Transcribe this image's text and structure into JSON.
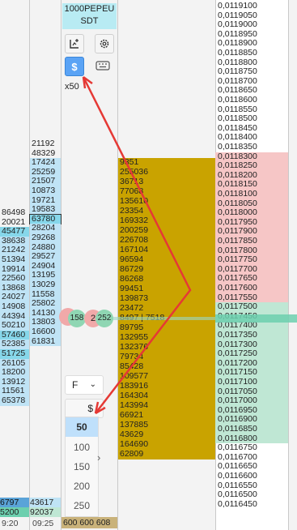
{
  "header": {
    "symbol_line1": "1000PEPEU",
    "symbol_line2": "SDT"
  },
  "toolbar": {
    "leverage": "x50",
    "dollar_icon": "$"
  },
  "order_panel": {
    "select_value": "F",
    "dollar_field": "$",
    "qty_options": [
      "50",
      "100",
      "150",
      "200",
      "250"
    ],
    "selected": "50",
    "chevron": "›"
  },
  "prices": [
    "0,0119100",
    "0,0119050",
    "0,0119000",
    "0,0118950",
    "0,0118900",
    "0,0118850",
    "0,0118800",
    "0,0118750",
    "0,0118700",
    "0,0118650",
    "0,0118600",
    "0,0118550",
    "0,0118500",
    "0,0118450",
    "0,0118400",
    "0,0118350",
    "0,0118300",
    "0,0118250",
    "0,0118200",
    "0,0118150",
    "0,0118100",
    "0,0118050",
    "0,0118000",
    "0,0117950",
    "0,0117900",
    "0,0117850",
    "0,0117800",
    "0,0117750",
    "0,0117700",
    "0,0117650",
    "0,0117600",
    "0,0117550",
    "0,0117500",
    "0,0117450",
    "0,0117400",
    "0,0117350",
    "0,0117300",
    "0,0117250",
    "0,0117200",
    "0,0117150",
    "0,0117100",
    "0,0117050",
    "0,0117000",
    "0,0116950",
    "0,0116900",
    "0,0116850",
    "0,0116800",
    "0,0116750",
    "0,0116700",
    "0,0116650",
    "0,0116600",
    "0,0116550",
    "0,0116500",
    "0,0116450"
  ],
  "book_volumes": [
    "9351",
    "255036",
    "36713",
    "77068",
    "135610",
    "23354",
    "169332",
    "200259",
    "226708",
    "167104",
    "96594",
    "86729",
    "86268",
    "99451",
    "139873",
    "23472",
    "8497 | 7518",
    "89795",
    "132955",
    "132376",
    "79734",
    "85428",
    "109577",
    "183916",
    "164304",
    "143994",
    "66921",
    "137885",
    "43629",
    "164690",
    "62809"
  ],
  "vol_col2": [
    "21192",
    "48329",
    "17424",
    "25259",
    "21507",
    "10873",
    "19721",
    "19583",
    "63780",
    "28204",
    "29268",
    "24880",
    "29527",
    "24904",
    "13195",
    "13029",
    "11558",
    "25802",
    "14130",
    "13803",
    "16600",
    "61831"
  ],
  "vol_col1": [
    "86498",
    "20021",
    "45477",
    "38638",
    "21242",
    "51394",
    "19914",
    "22560",
    "13868",
    "24027",
    "14908",
    "44394",
    "50210",
    "57460",
    "52385",
    "51725",
    "26105",
    "18200",
    "13912",
    "11561",
    "65378"
  ],
  "bubbles": [
    "158",
    "2",
    "252"
  ],
  "footer": {
    "v1": "6797",
    "v2": "43617",
    "v3": "5200",
    "v4": "92037",
    "t1": "9:20",
    "t2": "09:25",
    "totals": "600 600 608"
  }
}
